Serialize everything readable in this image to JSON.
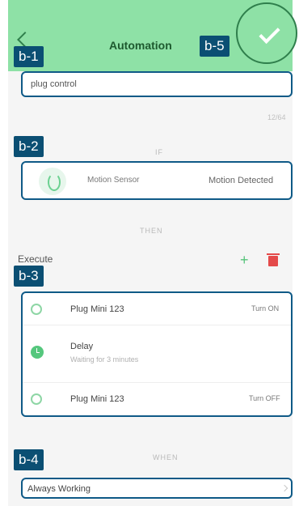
{
  "header": {
    "title": "Automation"
  },
  "annotations": {
    "b1": "b-1",
    "b2": "b-2",
    "b3": "b-3",
    "b4": "b-4",
    "b5": "b-5"
  },
  "name_field": {
    "value": "plug control",
    "counter": "12/64"
  },
  "sections": {
    "if": "IF",
    "then": "THEN",
    "when": "WHEN"
  },
  "if_condition": {
    "device": "Motion Sensor",
    "state": "Motion Detected"
  },
  "execute": {
    "label": "Execute"
  },
  "actions": [
    {
      "device": "Plug Mini 123",
      "state": "Turn ON"
    },
    {
      "title": "Delay",
      "subtitle": "Waiting for 3 minutes"
    },
    {
      "device": "Plug Mini 123",
      "state": "Turn OFF"
    }
  ],
  "when_field": {
    "value": "Always Working"
  },
  "colors": {
    "header": "#8ee1a6",
    "annotation": "#0b4f73",
    "accent": "#55c77d",
    "delete": "#e44a4a"
  }
}
